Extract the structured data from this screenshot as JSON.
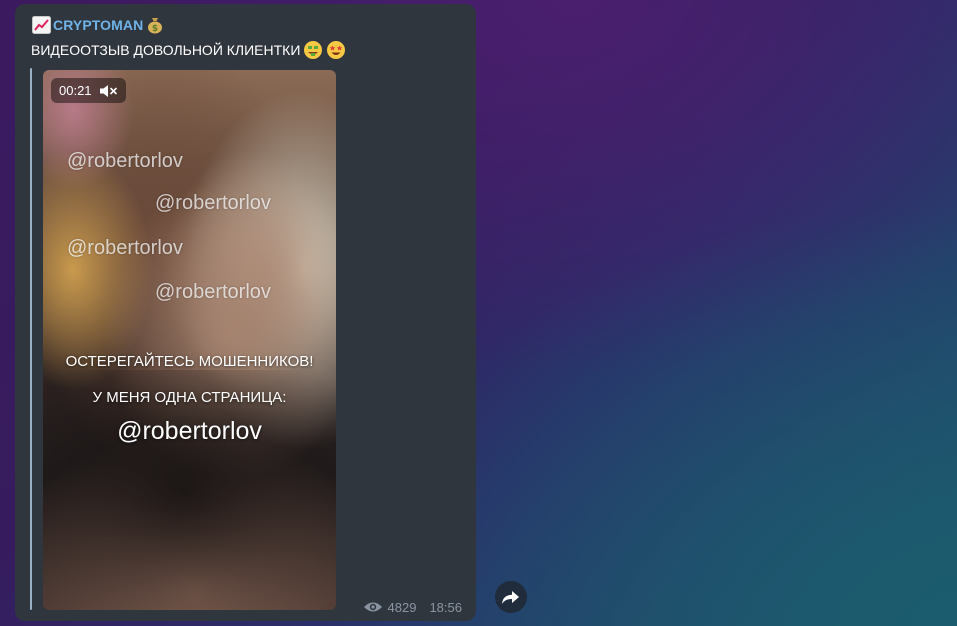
{
  "message": {
    "channel_name": "CRYPTOMAN",
    "channel_icon_left": "chart-increasing-icon",
    "channel_icon_right": "money-bag-icon",
    "caption": "ВИДЕООТЗЫВ ДОВОЛЬНОЙ КЛИЕНТКИ",
    "caption_emojis": [
      "money-mouth-face-icon",
      "star-struck-icon"
    ],
    "video": {
      "duration": "00:21",
      "sound_state": "muted",
      "watermarks": [
        "@robertorlov",
        "@robertorlov",
        "@robertorlov",
        "@robertorlov"
      ],
      "overlay_line1": "ОСТЕРЕГАЙТЕСЬ МОШЕННИКОВ!",
      "overlay_line2": "У МЕНЯ ОДНА СТРАНИЦА:",
      "overlay_line3": "@robertorlov"
    },
    "views": "4829",
    "time": "18:56"
  },
  "colors": {
    "bubble": "#30363e",
    "channel_name": "#6fb3e8",
    "meta_text": "#8a95a1",
    "quote_bar": "#9ab0c4"
  },
  "actions": {
    "share_icon": "share-arrow-icon"
  }
}
